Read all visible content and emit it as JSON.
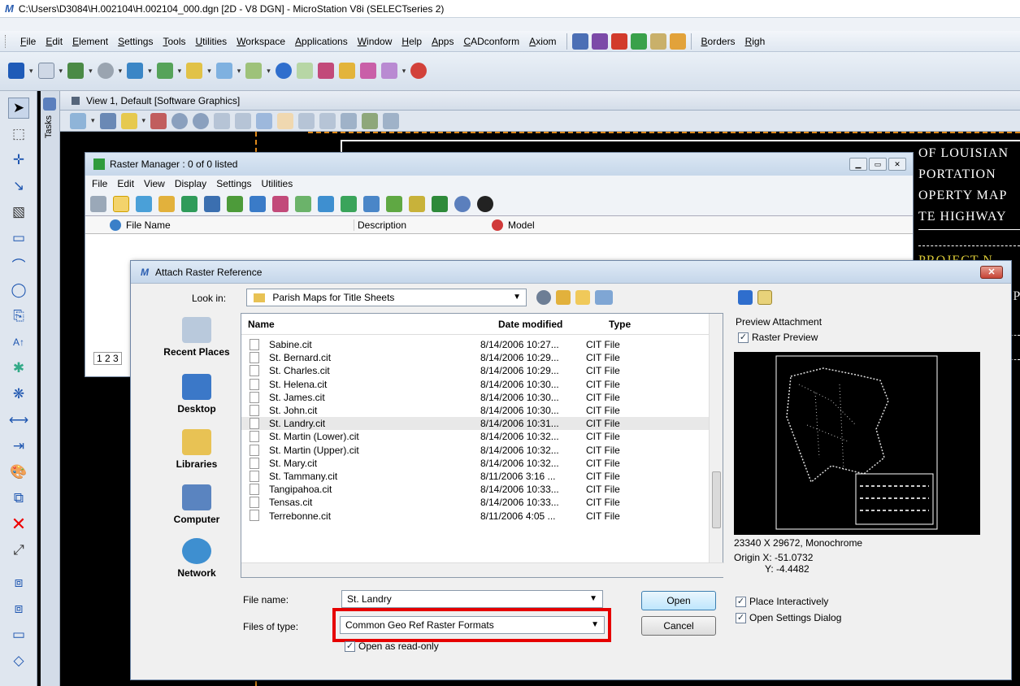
{
  "window": {
    "title": "C:\\Users\\D3084\\H.002104\\H.002104_000.dgn [2D - V8 DGN] - MicroStation V8i (SELECTseries 2)",
    "logo": "M"
  },
  "menu": [
    "File",
    "Edit",
    "Element",
    "Settings",
    "Tools",
    "Utilities",
    "Workspace",
    "Applications",
    "Window",
    "Help",
    "Apps",
    "CADconform",
    "Axiom"
  ],
  "menu_right": [
    "Borders",
    "Righ"
  ],
  "tasks_label": "Tasks",
  "view": {
    "title": "View 1, Default [Software Graphics]",
    "map_lines": [
      "OF LOUISIAN",
      "PORTATION",
      "OPERTY MAP",
      "TE HIGHWAY",
      "PROJECT N",
      "[P"
    ]
  },
  "raster_manager": {
    "title": "Raster Manager : 0 of 0 listed",
    "menu": [
      "File",
      "Edit",
      "View",
      "Display",
      "Settings",
      "Utilities"
    ],
    "columns": [
      "File Name",
      "Description",
      "Model"
    ],
    "tabs": "1 2 3"
  },
  "dialog": {
    "title": "Attach Raster Reference",
    "look_in_label": "Look in:",
    "look_in_value": "Parish Maps for Title Sheets",
    "places": [
      "Recent Places",
      "Desktop",
      "Libraries",
      "Computer",
      "Network"
    ],
    "columns": {
      "name": "Name",
      "date": "Date modified",
      "type": "Type"
    },
    "files": [
      {
        "name": "Sabine.cit",
        "date": "8/14/2006 10:27...",
        "type": "CIT File"
      },
      {
        "name": "St. Bernard.cit",
        "date": "8/14/2006 10:29...",
        "type": "CIT File"
      },
      {
        "name": "St. Charles.cit",
        "date": "8/14/2006 10:29...",
        "type": "CIT File"
      },
      {
        "name": "St. Helena.cit",
        "date": "8/14/2006 10:30...",
        "type": "CIT File"
      },
      {
        "name": "St. James.cit",
        "date": "8/14/2006 10:30...",
        "type": "CIT File"
      },
      {
        "name": "St. John.cit",
        "date": "8/14/2006 10:30...",
        "type": "CIT File"
      },
      {
        "name": "St. Landry.cit",
        "date": "8/14/2006 10:31...",
        "type": "CIT File"
      },
      {
        "name": "St. Martin (Lower).cit",
        "date": "8/14/2006 10:32...",
        "type": "CIT File"
      },
      {
        "name": "St. Martin (Upper).cit",
        "date": "8/14/2006 10:32...",
        "type": "CIT File"
      },
      {
        "name": "St. Mary.cit",
        "date": "8/14/2006 10:32...",
        "type": "CIT File"
      },
      {
        "name": "St. Tammany.cit",
        "date": "8/11/2006 3:16 ...",
        "type": "CIT File"
      },
      {
        "name": "Tangipahoa.cit",
        "date": "8/14/2006 10:33...",
        "type": "CIT File"
      },
      {
        "name": "Tensas.cit",
        "date": "8/14/2006 10:33...",
        "type": "CIT File"
      },
      {
        "name": "Terrebonne.cit",
        "date": "8/11/2006 4:05 ...",
        "type": "CIT File"
      }
    ],
    "selected_file": "St. Landry.cit",
    "file_name_label": "File name:",
    "file_name_value": "St. Landry",
    "files_of_type_label": "Files of type:",
    "files_of_type_value": "Common Geo Ref Raster Formats",
    "open_readonly": "Open as read-only",
    "open_btn": "Open",
    "cancel_btn": "Cancel",
    "preview_label": "Preview Attachment",
    "raster_preview": "Raster Preview",
    "preview_info": "23340 X 29672, Monochrome",
    "origin_x": "Origin X: -51.0732",
    "origin_y": "Y: -4.4482",
    "place_interactively": "Place Interactively",
    "open_settings": "Open Settings Dialog"
  },
  "colors": {
    "highlight": "#e60000",
    "titlebar": "#c6d7ea"
  }
}
